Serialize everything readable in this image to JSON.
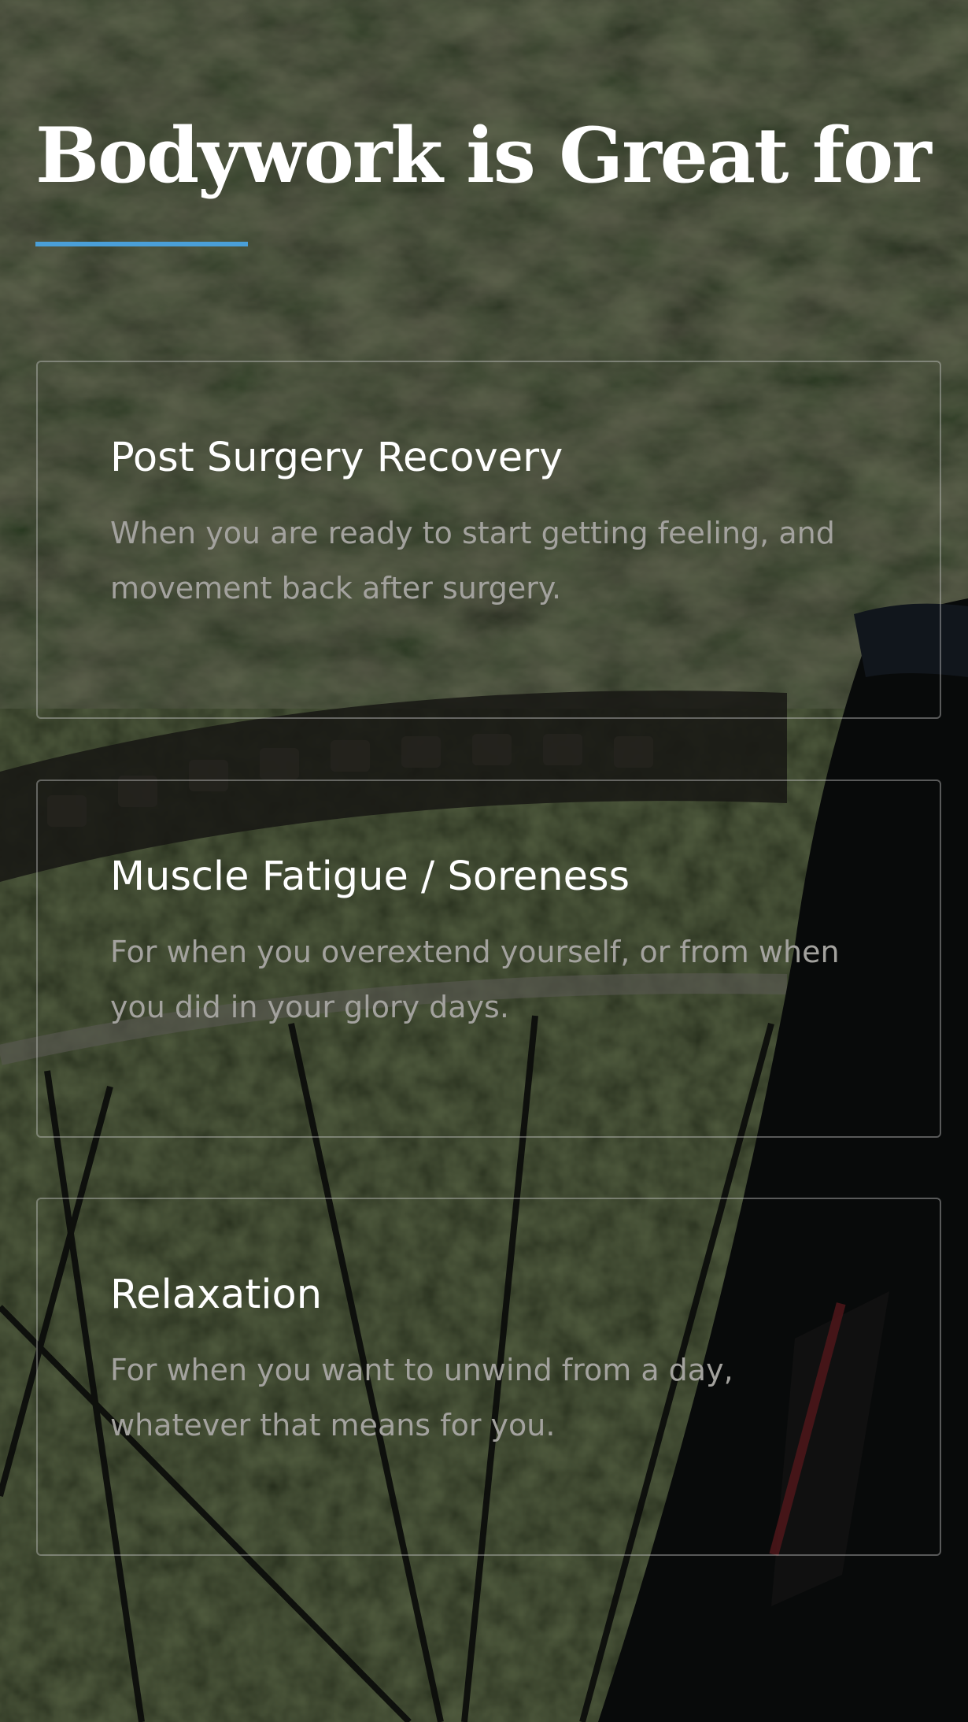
{
  "section": {
    "title": "Bodywork is Great for",
    "accent_color": "#4a9fd8"
  },
  "background": {
    "image": "mountain-bike-wheel-photo"
  },
  "cards": [
    {
      "title": "Post Surgery Recovery",
      "text": "When you are ready to start getting feeling, and movement back after surgery."
    },
    {
      "title": "Muscle Fatigue / Soreness",
      "text": "For when you overextend yourself, or from when you did in your glory days."
    },
    {
      "title": "Relaxation",
      "text": "For when you want to unwind from a day, whatever that means for you."
    }
  ]
}
